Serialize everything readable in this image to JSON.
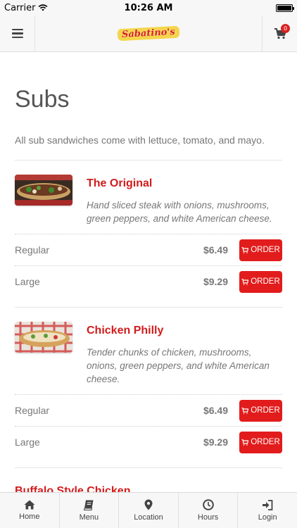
{
  "status_bar": {
    "carrier": "Carrier",
    "time": "10:26 AM"
  },
  "header": {
    "logo_text": "Sabatino's",
    "cart_count": "0"
  },
  "page": {
    "title": "Subs",
    "description": "All sub sandwiches come with lettuce, tomato, and mayo."
  },
  "items": [
    {
      "name": "The Original",
      "description": "Hand sliced steak with onions, mushrooms, green peppers, and white American cheese.",
      "prices": [
        {
          "label": "Regular",
          "price": "$6.49",
          "button": "ORDER"
        },
        {
          "label": "Large",
          "price": "$9.29",
          "button": "ORDER"
        }
      ]
    },
    {
      "name": "Chicken Philly",
      "description": "Tender chunks of chicken, mushrooms, onions, green peppers, and white American cheese.",
      "prices": [
        {
          "label": "Regular",
          "price": "$6.49",
          "button": "ORDER"
        },
        {
          "label": "Large",
          "price": "$9.29",
          "button": "ORDER"
        }
      ]
    },
    {
      "name": "Buffalo Style Chicken"
    }
  ],
  "tabs": [
    {
      "label": "Home",
      "icon": "home-icon"
    },
    {
      "label": "Menu",
      "icon": "book-icon"
    },
    {
      "label": "Location",
      "icon": "map-pin-icon"
    },
    {
      "label": "Hours",
      "icon": "clock-icon"
    },
    {
      "label": "Login",
      "icon": "login-icon"
    }
  ],
  "colors": {
    "accent": "#e21c1c",
    "title_red": "#d21c1c",
    "bar_bg": "#f7f7f7"
  }
}
